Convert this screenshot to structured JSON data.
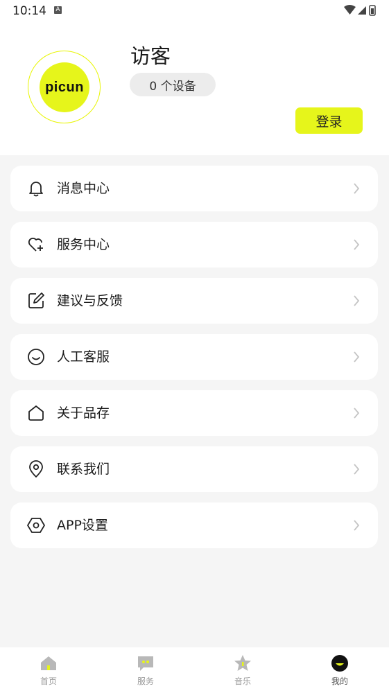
{
  "status_bar": {
    "time": "10:14",
    "notif_badge": "A"
  },
  "profile": {
    "logo_text": "picun",
    "username": "访客",
    "device_count": "0 个设备",
    "login_label": "登录"
  },
  "menu": [
    {
      "label": "消息中心",
      "icon": "bell-icon"
    },
    {
      "label": "服务中心",
      "icon": "heart-plus-icon"
    },
    {
      "label": "建议与反馈",
      "icon": "edit-icon"
    },
    {
      "label": "人工客服",
      "icon": "smile-icon"
    },
    {
      "label": "关于品存",
      "icon": "home-icon"
    },
    {
      "label": "联系我们",
      "icon": "location-icon"
    },
    {
      "label": "APP设置",
      "icon": "settings-icon"
    }
  ],
  "tabs": [
    {
      "label": "首页",
      "icon": "home-tab-icon"
    },
    {
      "label": "服务",
      "icon": "chat-tab-icon"
    },
    {
      "label": "音乐",
      "icon": "star-tab-icon"
    },
    {
      "label": "我的",
      "icon": "face-tab-icon",
      "active": true
    }
  ],
  "colors": {
    "accent": "#e6f51b",
    "background": "#f5f5f5",
    "card": "#ffffff"
  }
}
